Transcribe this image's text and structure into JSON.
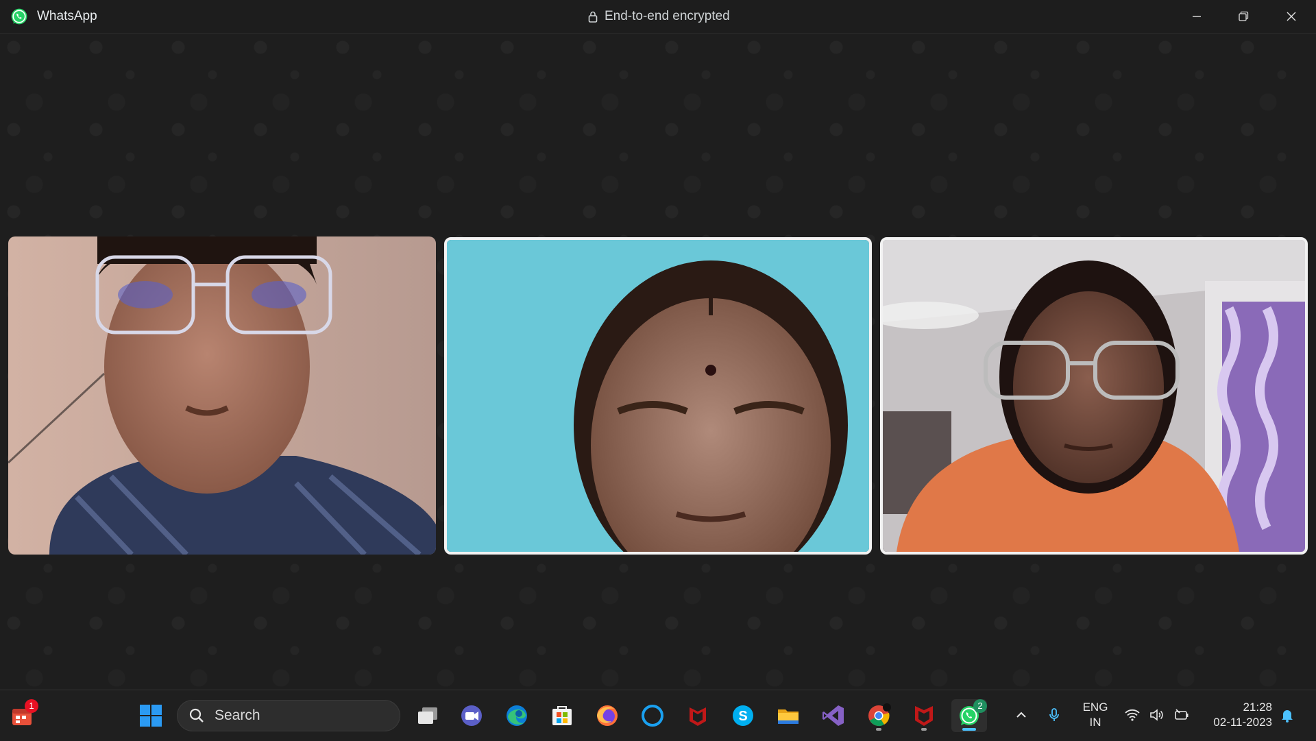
{
  "window": {
    "app_name": "WhatsApp",
    "encryption_label": "End-to-end encrypted",
    "controls": [
      "minimize-icon",
      "restore-icon",
      "close-icon"
    ]
  },
  "call": {
    "participants": [
      {
        "id": 1,
        "tile": "participant-video",
        "active_speaker": false
      },
      {
        "id": 2,
        "tile": "participant-video",
        "active_speaker": true
      },
      {
        "id": 3,
        "tile": "participant-video",
        "active_speaker": true
      }
    ]
  },
  "taskbar": {
    "widgets_badge": "1",
    "search_placeholder": "Search",
    "apps": [
      "windows-start",
      "task-view",
      "teams-meet",
      "edge",
      "microsoft-store",
      "firefox",
      "cortana",
      "mcafee",
      "skype",
      "file-explorer",
      "visual-studio",
      "chrome",
      "mcafee-security",
      "whatsapp"
    ],
    "whatsapp_badge": "2",
    "language": {
      "line1": "ENG",
      "line2": "IN"
    },
    "time": "21:28",
    "date": "02-11-2023"
  },
  "colors": {
    "whatsapp_green": "#25d366",
    "titlebar_bg": "#1d1d1d",
    "stage_bg": "#1e1e1e",
    "taskbar_bg": "#1f1f1f",
    "badge_red": "#e81123",
    "badge_green": "#1f8f5f"
  }
}
